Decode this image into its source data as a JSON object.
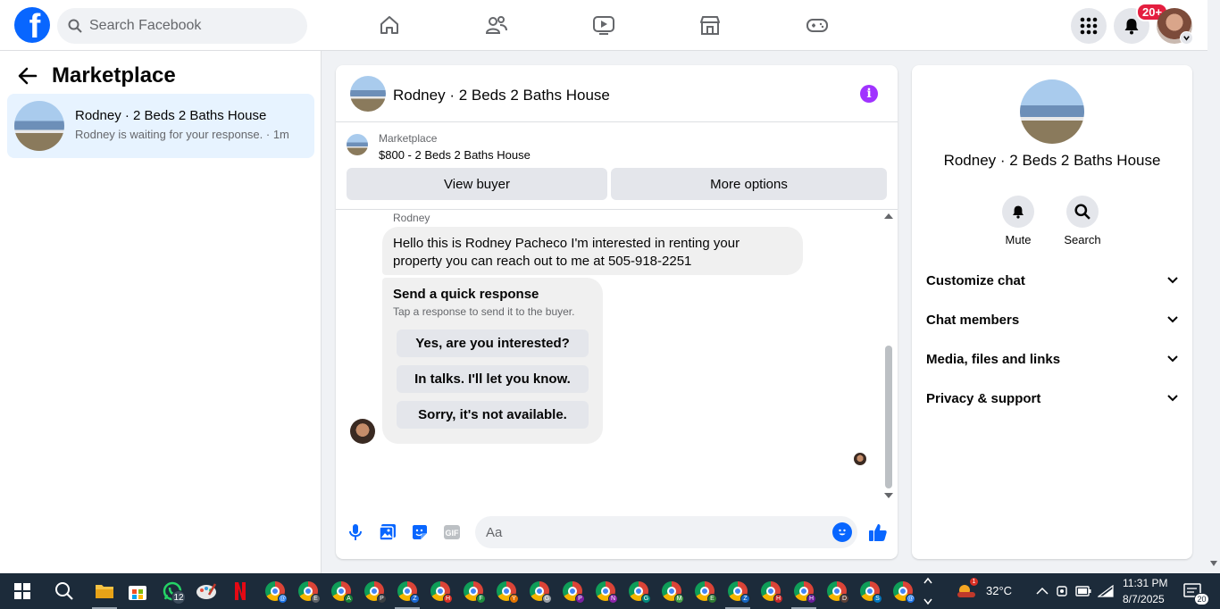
{
  "topbar": {
    "logo_letter": "f",
    "search_placeholder": "Search Facebook",
    "nav_icons": [
      "home-icon",
      "friends-icon",
      "video-icon",
      "marketplace-icon",
      "gaming-icon"
    ],
    "notification_badge": "20+"
  },
  "sidebar": {
    "title": "Marketplace",
    "conversation": {
      "title": "Rodney · 2 Beds 2 Baths House",
      "subtitle": "Rodney is waiting for your response. · 1m"
    }
  },
  "chat": {
    "title": "Rodney · 2 Beds 2 Baths House",
    "listing_label": "Marketplace",
    "listing_price": "$800 - 2 Beds 2 Baths House",
    "view_buyer_label": "View buyer",
    "more_options_label": "More options",
    "sender_name": "Rodney",
    "message": "Hello this is Rodney Pacheco I'm interested in renting your property you can reach out to me at 505-918-2251",
    "quick_title": "Send a quick response",
    "quick_subtitle": "Tap a response to send it to the buyer.",
    "quick_responses": [
      "Yes, are you interested?",
      "In talks. I'll let you know.",
      "Sorry, it's not available."
    ],
    "composer_placeholder": "Aa"
  },
  "details": {
    "title": "Rodney · 2 Beds 2 Baths House",
    "mute_label": "Mute",
    "search_label": "Search",
    "sections": [
      "Customize chat",
      "Chat members",
      "Media, files and links",
      "Privacy & support"
    ]
  },
  "taskbar": {
    "whatsapp_badge": "12",
    "weather_badge": "1",
    "temperature": "32°C",
    "time": "11:31 PM",
    "date": "8/7/2025",
    "notification_count": "20",
    "chrome_profiles": [
      "@",
      "E",
      "A",
      "P",
      "Z",
      "H",
      "F",
      "Y",
      "G",
      "P",
      "N",
      "G",
      "M",
      "E",
      "Z",
      "H",
      "H",
      "D",
      "S",
      "@"
    ]
  },
  "colors": {
    "brand": "#0866ff",
    "selected_bg": "#e7f3ff",
    "info_purple": "#a033ff",
    "badge_red": "#e41e3f"
  }
}
